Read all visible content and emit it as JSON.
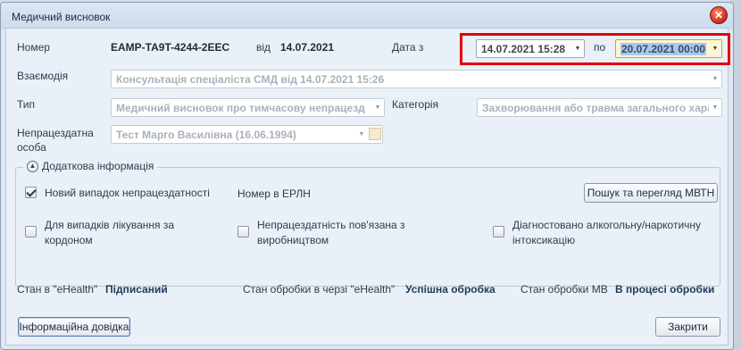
{
  "window": {
    "title": "Медичний висновок"
  },
  "header": {
    "number_label": "Номер",
    "number_value": "EAMP-TA9T-4244-2EEC",
    "from_label": "від",
    "from_date": "14.07.2021",
    "date_from_label": "Дата з",
    "date_from_value": "14.07.2021 15:28",
    "to_label": "по",
    "date_to_value": "20.07.2021 00:00"
  },
  "interaction": {
    "label": "Взаємодія",
    "value": "Консультація спеціаліста СМД від 14.07.2021 15:26"
  },
  "type": {
    "label": "Тип",
    "value": "Медичний висновок про тимчасову непрацезд"
  },
  "category": {
    "label": "Категорія",
    "value": "Захворювання або травма загального хара"
  },
  "person": {
    "label_line1": "Непрацездатна",
    "label_line2": "особа",
    "value": "Тест Марго Василівна (16.06.1994)"
  },
  "additional": {
    "title": "Додаткова інформація",
    "new_case_label": "Новий випадок непрацездатності",
    "new_case_checked": true,
    "erln_label": "Номер в ЕРЛН",
    "search_button": "Пошук та перегляд МВТН",
    "abroad_line1": "Для випадків лікування за",
    "abroad_line2": "кордоном",
    "work_line1": "Непрацездатність пов'язана з",
    "work_line2": "виробництвом",
    "alcohol_line1": "Діагностовано алкогольну/наркотичну",
    "alcohol_line2": "інтоксикацію"
  },
  "status": {
    "ehealth_label": "Стан в \"eHealth\"",
    "ehealth_value": "Підписаний",
    "queue_label": "Стан обробки в черзі \"eHealth\"",
    "queue_value": "Успішна обробка",
    "mv_label": "Стан обробки МВ",
    "mv_value": "В процесі обробки"
  },
  "footer": {
    "info_button": "Інформаційна довідка",
    "close_button": "Закрити"
  },
  "icons": {
    "close": "close-icon",
    "dropdown": "chevron-down-icon",
    "collapse": "chevron-up-icon",
    "calendar": "calendar-icon"
  },
  "colors": {
    "highlight_border": "#e00000",
    "focused_field": "#fff6d5",
    "selection": "#a8c8ee",
    "close_button": "#d6351f"
  }
}
